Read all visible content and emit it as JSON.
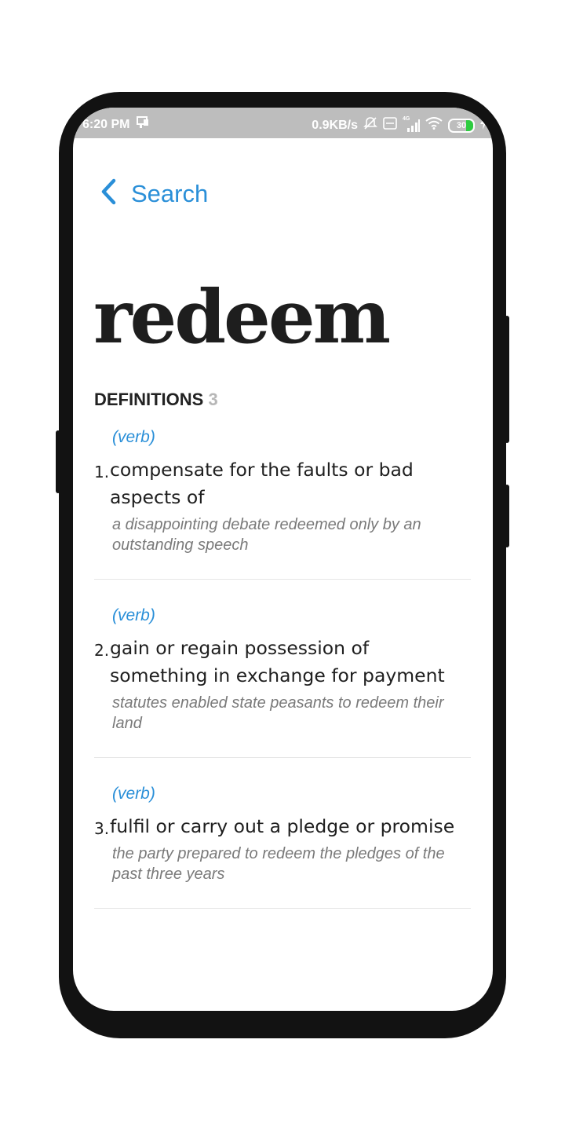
{
  "status_bar": {
    "time": "6:20 PM",
    "speed": "0.9KB/s",
    "network": "4G",
    "battery": "30"
  },
  "nav": {
    "back_label": "Search"
  },
  "word": "redeem",
  "definitions_header": {
    "label": "DEFINITIONS",
    "count": "3"
  },
  "definitions": [
    {
      "number": "1.",
      "part_of_speech": "(verb)",
      "meaning": "compensate for the faults or bad aspects of",
      "example": "a disappointing debate redeemed only by an outstanding speech"
    },
    {
      "number": "2.",
      "part_of_speech": "(verb)",
      "meaning": "gain or regain possession of something in exchange for payment",
      "example": "statutes enabled state peasants to redeem their land"
    },
    {
      "number": "3.",
      "part_of_speech": "(verb)",
      "meaning": "fulfil or carry out a pledge or promise",
      "example": "the party prepared to redeem the pledges of the past three years"
    }
  ],
  "colors": {
    "accent": "#2a8fd8",
    "status_bar_bg": "#bdbdbd",
    "phone_frame": "#121212",
    "battery_fill": "#2ecc40"
  }
}
